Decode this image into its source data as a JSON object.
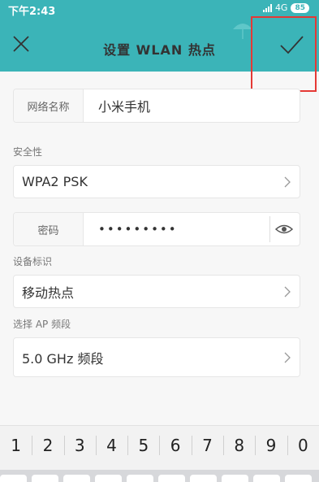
{
  "status_bar": {
    "time": "下午2:43",
    "network": "4G",
    "battery": "85"
  },
  "header": {
    "title": "设置 WLAN 热点",
    "close_icon": "close-icon",
    "confirm_icon": "check-icon",
    "accent_color": "#3bb4b8"
  },
  "form": {
    "network_name": {
      "label": "网络名称",
      "value": "小米手机"
    },
    "security": {
      "section_label": "安全性",
      "value": "WPA2 PSK"
    },
    "password": {
      "label": "密码",
      "value": "•••••••••"
    },
    "device_id": {
      "section_label": "设备标识",
      "value": "移动热点"
    },
    "ap_band": {
      "section_label": "选择 AP 频段",
      "value": "5.0 GHz 频段"
    }
  },
  "keyboard": {
    "digits": [
      "1",
      "2",
      "3",
      "4",
      "5",
      "6",
      "7",
      "8",
      "9",
      "0"
    ]
  }
}
